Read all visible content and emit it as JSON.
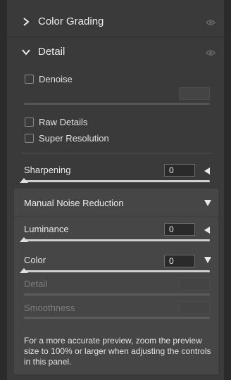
{
  "color_grading": {
    "title": "Color Grading",
    "icon": "chevron-right-icon"
  },
  "detail": {
    "title": "Detail",
    "icon": "chevron-down-icon",
    "denoise_label": "Denoise",
    "raw_details_label": "Raw Details",
    "super_resolution_label": "Super Resolution",
    "sharpening": {
      "label": "Sharpening",
      "value": "0"
    },
    "manual_noise_reduction": {
      "title": "Manual Noise Reduction",
      "luminance": {
        "label": "Luminance",
        "value": "0"
      },
      "color": {
        "label": "Color",
        "value": "0"
      },
      "detail_label": "Detail",
      "smoothness_label": "Smoothness"
    },
    "note": "For a more accurate preview, zoom the preview size to 100% or larger when adjusting the controls in this panel."
  }
}
